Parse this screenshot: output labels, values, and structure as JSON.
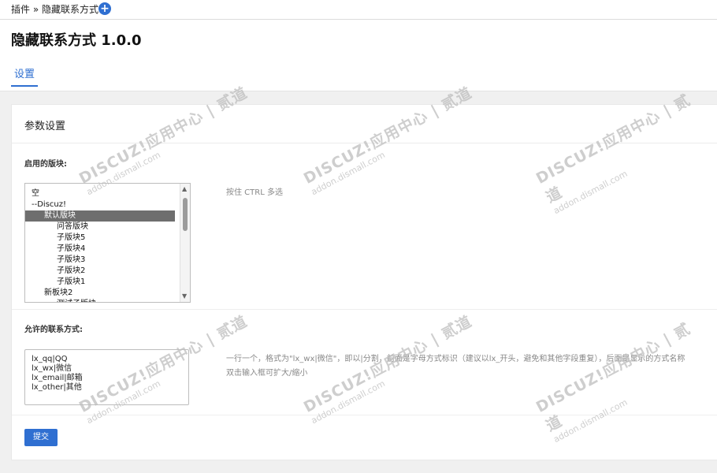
{
  "topbar": {
    "breadcrumb": "插件 » 隐藏联系方式",
    "add_icon": "+"
  },
  "header": {
    "title": "隐藏联系方式 1.0.0",
    "tab_settings": "设置"
  },
  "panel": {
    "title": "参数设置",
    "section_boards": {
      "label": "启用的版块:",
      "hint": "按住 CTRL 多选",
      "options": [
        {
          "label": "空",
          "indent": 0,
          "selected": false
        },
        {
          "label": "--Discuz!",
          "indent": 0,
          "selected": false
        },
        {
          "label": "默认版块",
          "indent": 1,
          "selected": true
        },
        {
          "label": "问答版块",
          "indent": 2,
          "selected": false
        },
        {
          "label": "子版块5",
          "indent": 2,
          "selected": false
        },
        {
          "label": "子版块4",
          "indent": 2,
          "selected": false
        },
        {
          "label": "子版块3",
          "indent": 2,
          "selected": false
        },
        {
          "label": "子版块2",
          "indent": 2,
          "selected": false
        },
        {
          "label": "子版块1",
          "indent": 2,
          "selected": false
        },
        {
          "label": "新板块2",
          "indent": 1,
          "selected": false
        },
        {
          "label": "测试子版块",
          "indent": 2,
          "selected": false
        }
      ]
    },
    "section_contacts": {
      "label": "允许的联系方式:",
      "hint_line1": "一行一个，格式为\"lx_wx|微信\"，即以|分割，前面是字母方式标识（建议以lx_开头，避免和其他字段重复），后面是显示的方式名称",
      "hint_line2": "双击输入框可扩大/缩小",
      "textarea_lines": [
        "lx_qq|QQ",
        "lx_wx|微信",
        "lx_email|邮箱",
        "lx_other|其他"
      ]
    },
    "submit_label": "提交"
  },
  "watermark": {
    "text": "DISCUZ!应用中心 | 贰道",
    "sub": "addon.dismall.com"
  }
}
